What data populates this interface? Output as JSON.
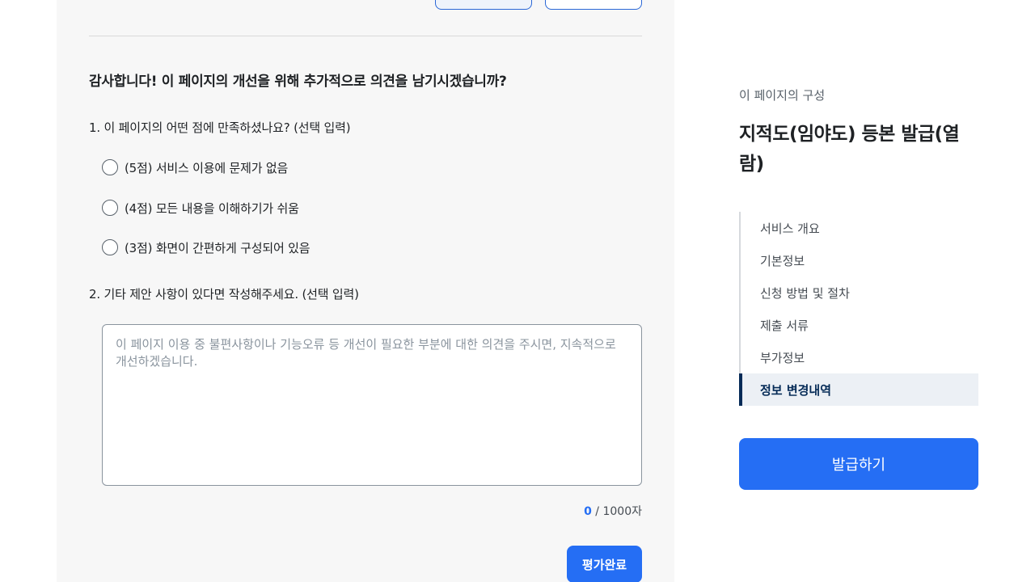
{
  "feedback": {
    "title": "감사합니다! 이 페이지의 개선을 위해 추가적으로 의견을 남기시겠습니까?",
    "question1": "1. 이 페이지의 어떤 점에 만족하셨나요? (선택 입력)",
    "options": [
      "(5점) 서비스 이용에 문제가 없음",
      "(4점) 모든 내용을 이해하기가 쉬움",
      "(3점) 화면이 간편하게 구성되어 있음"
    ],
    "question2": "2. 기타 제안 사항이 있다면 작성해주세요. (선택 입력)",
    "textarea_placeholder": "이 페이지 이용 중 불편사항이나 기능오류 등 개선이 필요한 부분에 대한 의견을 주시면, 지속적으로 개선하겠습니다.",
    "char_count": "0",
    "char_limit": " / 1000자",
    "submit_label": "평가완료"
  },
  "sidebar": {
    "caption": "이 페이지의 구성",
    "title": "지적도(임야도) 등본 발급(열람)",
    "toc": [
      "서비스 개요",
      "기본정보",
      "신청 방법 및 절차",
      "제출 서류",
      "부가정보",
      "정보 변경내역"
    ],
    "active_index": 5,
    "issue_label": "발급하기"
  },
  "colors": {
    "primary": "#256ef4",
    "active_nav": "#052b57",
    "panel_bg": "#f7f7f7"
  }
}
